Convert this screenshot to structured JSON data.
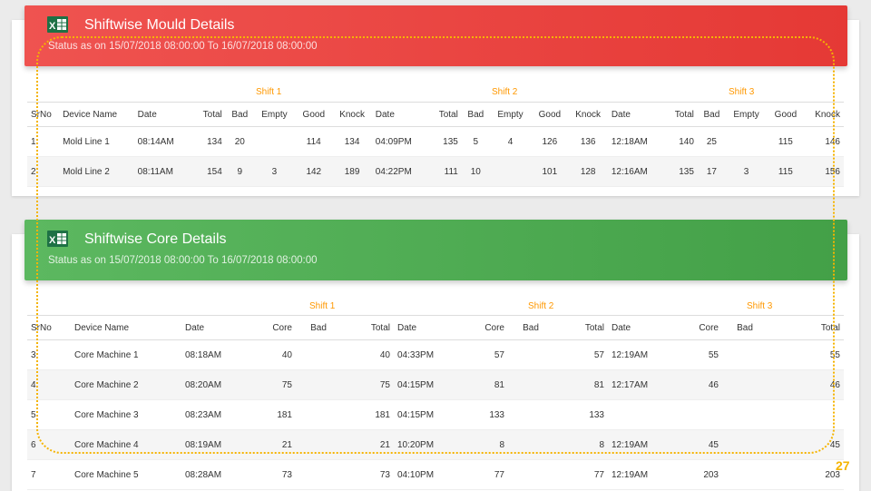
{
  "colors": {
    "red": "#e53935",
    "green": "#43a047",
    "shift_label": "#ff9800",
    "annotation": "#f5b400"
  },
  "icons": {
    "excel": "excel-icon"
  },
  "mould": {
    "title": "Shiftwise Mould Details",
    "status": "Status as on 15/07/2018 08:00:00 To 16/07/2018 08:00:00",
    "shift_labels": [
      "Shift 1",
      "Shift 2",
      "Shift 3"
    ],
    "columns": [
      "SrNo",
      "Device Name",
      "Date",
      "Total",
      "Bad",
      "Empty",
      "Good",
      "Knock",
      "Date",
      "Total",
      "Bad",
      "Empty",
      "Good",
      "Knock",
      "Date",
      "Total",
      "Bad",
      "Empty",
      "Good",
      "Knock"
    ],
    "rows": [
      [
        "1",
        "Mold Line 1",
        "08:14AM",
        "134",
        "20",
        "",
        "114",
        "134",
        "04:09PM",
        "135",
        "5",
        "4",
        "126",
        "136",
        "12:18AM",
        "140",
        "25",
        "",
        "115",
        "146"
      ],
      [
        "2",
        "Mold Line 2",
        "08:11AM",
        "154",
        "9",
        "3",
        "142",
        "189",
        "04:22PM",
        "111",
        "10",
        "",
        "101",
        "128",
        "12:16AM",
        "135",
        "17",
        "3",
        "115",
        "156"
      ]
    ]
  },
  "core": {
    "title": "Shiftwise Core Details",
    "status": "Status as on 15/07/2018 08:00:00 To 16/07/2018 08:00:00",
    "shift_labels": [
      "Shift 1",
      "Shift 2",
      "Shift 3"
    ],
    "columns": [
      "SrNo",
      "Device Name",
      "Date",
      "Core",
      "Bad",
      "Total",
      "Date",
      "Core",
      "Bad",
      "Total",
      "Date",
      "Core",
      "Bad",
      "Total"
    ],
    "rows": [
      [
        "3",
        "Core Machine 1",
        "08:18AM",
        "40",
        "",
        "40",
        "04:33PM",
        "57",
        "",
        "57",
        "12:19AM",
        "55",
        "",
        "55"
      ],
      [
        "4",
        "Core Machine 2",
        "08:20AM",
        "75",
        "",
        "75",
        "04:15PM",
        "81",
        "",
        "81",
        "12:17AM",
        "46",
        "",
        "46"
      ],
      [
        "5",
        "Core Machine 3",
        "08:23AM",
        "181",
        "",
        "181",
        "04:15PM",
        "133",
        "",
        "133",
        "",
        "",
        "",
        ""
      ],
      [
        "6",
        "Core Machine 4",
        "08:19AM",
        "21",
        "",
        "21",
        "10:20PM",
        "8",
        "",
        "8",
        "12:19AM",
        "45",
        "",
        "45"
      ],
      [
        "7",
        "Core Machine 5",
        "08:28AM",
        "73",
        "",
        "73",
        "04:10PM",
        "77",
        "",
        "77",
        "12:19AM",
        "203",
        "",
        "203"
      ]
    ]
  },
  "annotation": {
    "page_number": "27"
  }
}
